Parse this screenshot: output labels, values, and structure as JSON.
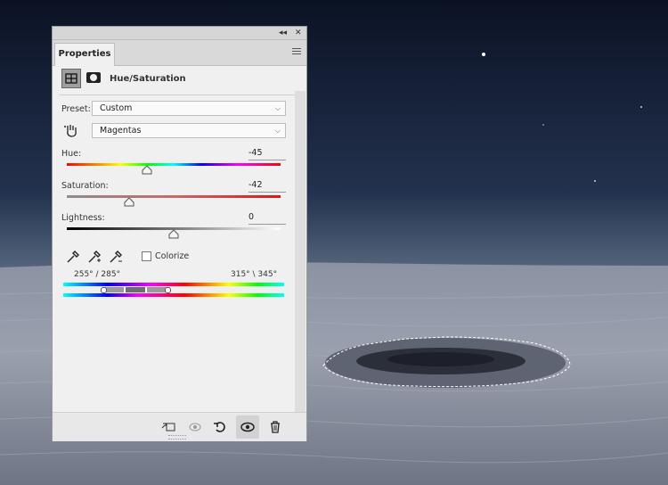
{
  "panel": {
    "collapse_glyph": "◂◂",
    "close_glyph": "✕",
    "tab_label": "Properties",
    "adjustment_title": "Hue/Saturation",
    "preset_label": "Preset:",
    "preset_value": "Custom",
    "channel_value": "Magentas",
    "hue_label": "Hue:",
    "hue_value": "-45",
    "hue_level": -45,
    "saturation_label": "Saturation:",
    "saturation_value": "-42",
    "saturation_level": -42,
    "lightness_label": "Lightness:",
    "lightness_value": "0",
    "lightness_level": 0,
    "colorize_label": "Colorize",
    "range_left": "255° / 285°",
    "range_right": "315° \\ 345°"
  },
  "icons": {
    "adjust": "adjustment-layer-icon",
    "mask": "mask-icon",
    "hand": "targeted-adjustment-hand-icon",
    "eyedrop": "eyedropper-icon",
    "eyedrop_add": "eyedropper-add-icon",
    "eyedrop_sub": "eyedropper-subtract-icon",
    "clip": "clip-to-layer-icon",
    "view_prev": "view-previous-state-icon",
    "reset": "reset-icon",
    "visibility": "visibility-eye-icon",
    "delete": "trash-icon"
  }
}
